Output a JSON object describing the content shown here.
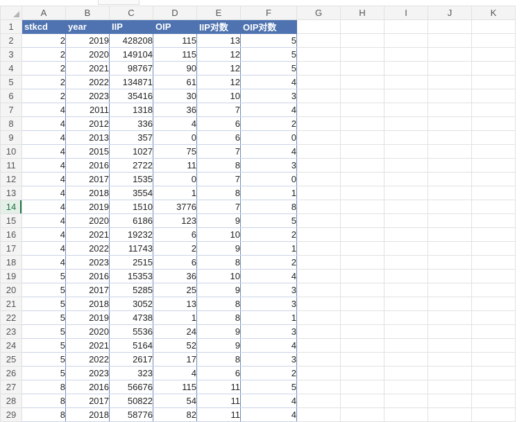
{
  "columns": [
    "A",
    "B",
    "C",
    "D",
    "E",
    "F",
    "G",
    "H",
    "I",
    "J",
    "K"
  ],
  "header": [
    "stkcd",
    "year",
    "IIP",
    "OIP",
    "IIP对数",
    "OIP对数"
  ],
  "rows": [
    [
      2,
      2019,
      428208,
      115,
      13,
      5
    ],
    [
      2,
      2020,
      149104,
      115,
      12,
      5
    ],
    [
      2,
      2021,
      98767,
      90,
      12,
      5
    ],
    [
      2,
      2022,
      134871,
      61,
      12,
      4
    ],
    [
      2,
      2023,
      35416,
      30,
      10,
      3
    ],
    [
      4,
      2011,
      1318,
      36,
      7,
      4
    ],
    [
      4,
      2012,
      336,
      4,
      6,
      2
    ],
    [
      4,
      2013,
      357,
      0,
      6,
      0
    ],
    [
      4,
      2015,
      1027,
      75,
      7,
      4
    ],
    [
      4,
      2016,
      2722,
      11,
      8,
      3
    ],
    [
      4,
      2017,
      1535,
      0,
      7,
      0
    ],
    [
      4,
      2018,
      3554,
      1,
      8,
      1
    ],
    [
      4,
      2019,
      1510,
      3776,
      7,
      8
    ],
    [
      4,
      2020,
      6186,
      123,
      9,
      5
    ],
    [
      4,
      2021,
      19232,
      6,
      10,
      2
    ],
    [
      4,
      2022,
      11743,
      2,
      9,
      1
    ],
    [
      4,
      2023,
      2515,
      6,
      8,
      2
    ],
    [
      5,
      2016,
      15353,
      36,
      10,
      4
    ],
    [
      5,
      2017,
      5285,
      25,
      9,
      3
    ],
    [
      5,
      2018,
      3052,
      13,
      8,
      3
    ],
    [
      5,
      2019,
      4738,
      1,
      8,
      1
    ],
    [
      5,
      2020,
      5536,
      24,
      9,
      3
    ],
    [
      5,
      2021,
      5164,
      52,
      9,
      4
    ],
    [
      5,
      2022,
      2617,
      17,
      8,
      3
    ],
    [
      5,
      2023,
      323,
      4,
      6,
      2
    ],
    [
      8,
      2016,
      56676,
      115,
      11,
      5
    ],
    [
      8,
      2017,
      50822,
      54,
      11,
      4
    ],
    [
      8,
      2018,
      58776,
      82,
      11,
      4
    ]
  ],
  "active_row": 14,
  "colors": {
    "header_fill": "#4e73b0",
    "header_text": "#ffffff",
    "active_row_header": "#1e7145"
  }
}
